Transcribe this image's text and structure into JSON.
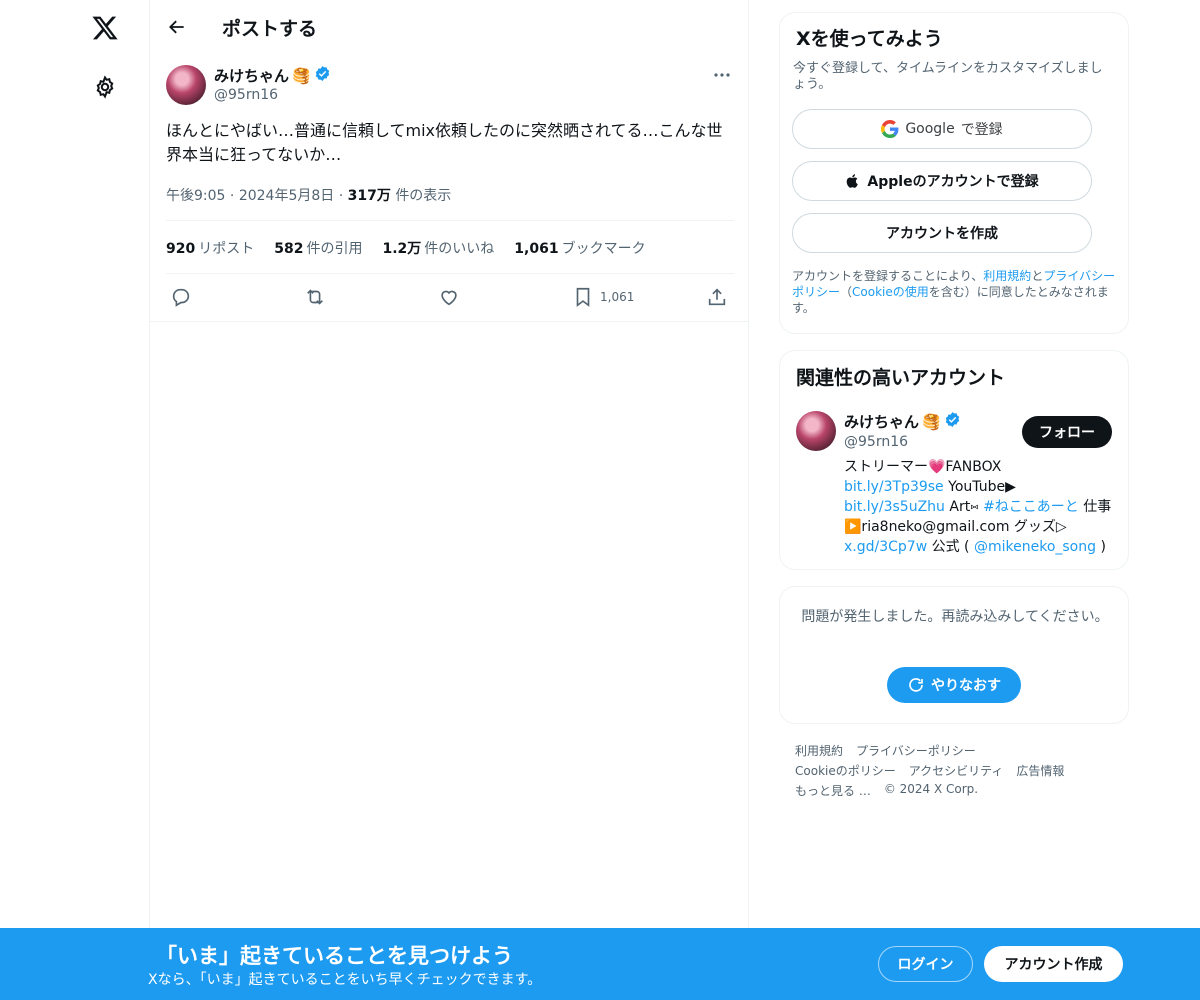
{
  "nav": {
    "logo_icon": "x-logo-icon",
    "settings_icon": "gear-icon"
  },
  "header": {
    "title": "ポストする"
  },
  "post": {
    "author_name": "みけちゃん",
    "author_emoji": "🥞",
    "handle": "@95rn16",
    "text": "ほんとにやばい…普通に信頼してmix依頼したのに突然晒されてる…こんな世界本当に狂ってないか…",
    "time": "午後9:05",
    "sep": "·",
    "date": "2024年5月8日",
    "views_count": "317万",
    "views_label": "件の表示",
    "stats": {
      "reposts_count": "920",
      "reposts_label": "リポスト",
      "quotes_count": "582",
      "quotes_label": "件の引用",
      "likes_count": "1.2万",
      "likes_label": "件のいいね",
      "bookmarks_count": "1,061",
      "bookmarks_label": "ブックマーク"
    },
    "bookmark_action_count": "1,061"
  },
  "signup": {
    "title": "Xを使ってみよう",
    "subtitle": "今すぐ登録して、タイムラインをカスタマイズしましょう。",
    "google_label": "Google",
    "google_suffix": "で登録",
    "apple_label": "Appleのアカウントで登録",
    "create_label": "アカウントを作成",
    "terms_1": "アカウントを登録することにより、",
    "terms_link_1": "利用規約",
    "terms_2": "と",
    "terms_link_2": "プライバシーポリシー",
    "terms_3": "（",
    "terms_link_3": "Cookieの使用",
    "terms_4": "を含む）に同意したとみなされます。"
  },
  "recommend": {
    "title": "関連性の高いアカウント",
    "name": "みけちゃん",
    "emoji": "🥞",
    "handle": "@95rn16",
    "follow_label": "フォロー",
    "bio_1": "ストリーマー💗FANBOX",
    "bio_link_1": "bit.ly/3Tp39se",
    "bio_2": " YouTube▶",
    "bio_link_2": "bit.ly/3s5uZhu",
    "bio_3": " Art⑅",
    "bio_link_3": "#ねここあーと",
    "bio_4": " 仕事▶️ria8neko@gmail.com グッズ▷",
    "bio_link_4": "x.gd/3Cp7w",
    "bio_5": " 公式 ( ",
    "bio_link_5": "@mikeneko_song",
    "bio_6": " )"
  },
  "error": {
    "message": "問題が発生しました。再読み込みしてください。",
    "retry_label": "やりなおす"
  },
  "footer": {
    "row1": [
      "利用規約",
      "プライバシーポリシー"
    ],
    "row2": [
      "Cookieのポリシー",
      "アクセシビリティ",
      "広告情報"
    ],
    "row3": [
      "もっと見る …",
      "© 2024 X Corp."
    ]
  },
  "bottom_bar": {
    "title": "「いま」起きていることを見つけよう",
    "subtitle": "Xなら、「いま」起きていることをいち早くチェックできます。",
    "login_label": "ログイン",
    "create_label": "アカウント作成"
  },
  "colors": {
    "accent": "#1d9bf0",
    "text": "#0f1419",
    "muted": "#536471",
    "border": "#eff3f4"
  }
}
